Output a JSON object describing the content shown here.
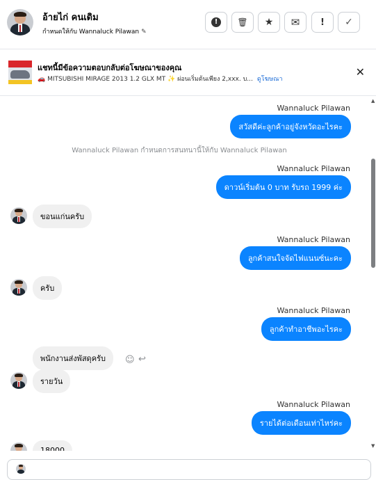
{
  "header": {
    "name": "อ้ายไก่ คนเดิม",
    "assigned_text": "กำหนดให้กับ Wannaluck Pilawan",
    "pencil": "✎",
    "toolbar": [
      {
        "icon": "alert-circle-icon",
        "glyph": "!"
      },
      {
        "icon": "trash-icon",
        "glyph": "🗑"
      },
      {
        "icon": "star-icon",
        "glyph": "★"
      },
      {
        "icon": "mail-icon",
        "glyph": "✉"
      },
      {
        "icon": "exclamation-icon",
        "glyph": "!"
      },
      {
        "icon": "check-icon",
        "glyph": "✓"
      }
    ]
  },
  "ad": {
    "title": "แชทนี้มีข้อความตอบกลับต่อโฆษณาของคุณ",
    "subtitle": "🚗 MITSUBISHI MIRAGE 2013 1.2 GLX MT ✨ ผ่อนเริ่มต้นเพียง 2,xxx. บ...",
    "link": "ดูโฆษณา",
    "close": "✕"
  },
  "messages": {
    "m1_sender": "Wannaluck Pilawan",
    "m1_text": "สวัสดีค่ะลูกค้าอยู่จังหวัดอะไรคะ",
    "sys_text": "Wannaluck Pilawan กำหนดการสนทนานี้ให้กับ Wannaluck Pilawan",
    "m2_sender": "Wannaluck Pilawan",
    "m2_text": "ดาวน์เริ่มต้น 0 บาท รับรถ 1999 ค่ะ",
    "m3_text": "ขอนแก่นครับ",
    "m4_sender": "Wannaluck Pilawan",
    "m4_text": "ลูกค้าสนใจจัดไฟแนนซ์นะคะ",
    "m5_text": "ครับ",
    "m6_sender": "Wannaluck Pilawan",
    "m6_text": "ลูกค้าทำอาชีพอะไรคะ",
    "m7_text": "พนักงานส่งพัสดุครับ",
    "m8_text": "รายวัน",
    "m9_sender": "Wannaluck Pilawan",
    "m9_text": "รายได้ต่อเดือนเท่าไหร่คะ",
    "m10_text": "18000",
    "react_emoji": "☺",
    "react_reply": "↩"
  },
  "scrollbar": {
    "up": "▲",
    "down": "▼"
  },
  "colors": {
    "outgoing_bubble": "#0b84ff",
    "incoming_bubble": "#f0f0f0",
    "link": "#1a6bd6"
  }
}
